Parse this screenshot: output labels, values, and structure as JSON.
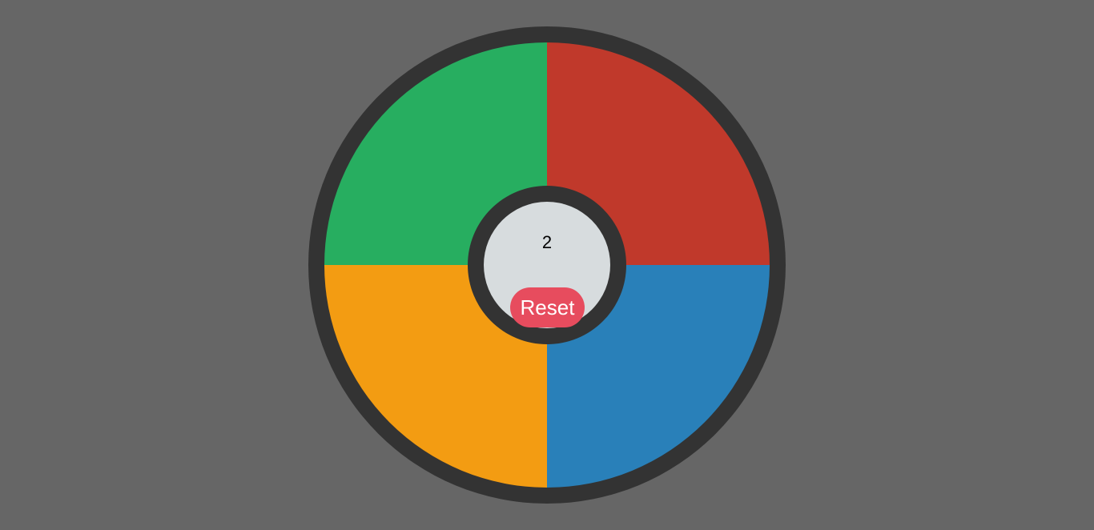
{
  "game": {
    "count": "2",
    "reset_label": "Reset"
  },
  "colors": {
    "background": "#666666",
    "board_ring": "#333333",
    "center_fill": "#d7dcde",
    "green": "#27ae60",
    "red": "#c0392b",
    "yellow": "#f39c12",
    "blue": "#2980b9",
    "reset_button": "#e74c5e"
  },
  "quadrants": [
    {
      "id": "green",
      "color": "#27ae60"
    },
    {
      "id": "red",
      "color": "#c0392b"
    },
    {
      "id": "yellow",
      "color": "#f39c12"
    },
    {
      "id": "blue",
      "color": "#2980b9"
    }
  ]
}
